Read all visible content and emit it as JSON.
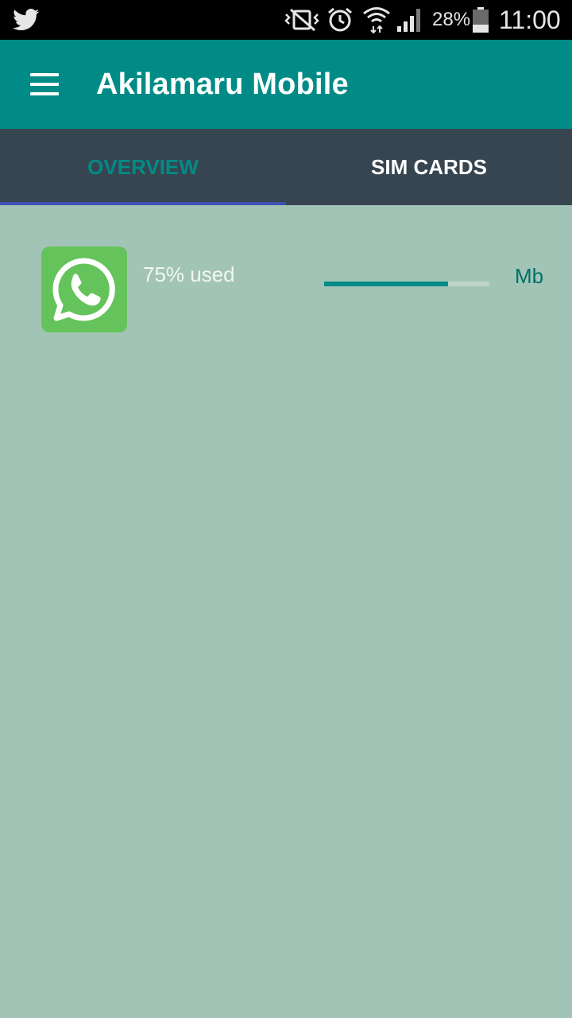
{
  "status_bar": {
    "battery_text": "28%",
    "time": "11:00",
    "icons": [
      "twitter-icon",
      "vibrate-off-icon",
      "alarm-icon",
      "wifi-icon",
      "signal-icon",
      "battery-icon"
    ]
  },
  "app_bar": {
    "title": "Akilamaru Mobile",
    "menu_icon": "hamburger-menu-icon"
  },
  "tabs": [
    {
      "label": "OVERVIEW",
      "selected": true
    },
    {
      "label": "SIM CARDS",
      "selected": false
    }
  ],
  "usage": {
    "app_icon": "whatsapp-icon",
    "used_text": "75% used",
    "progress_fraction": 0.75,
    "unit": "Mb"
  },
  "colors": {
    "primary": "#008b87",
    "tab_bar": "#36454f",
    "tab_indicator": "#3f51b5",
    "background": "#a2c4b6",
    "whatsapp_green": "#64c35a"
  }
}
